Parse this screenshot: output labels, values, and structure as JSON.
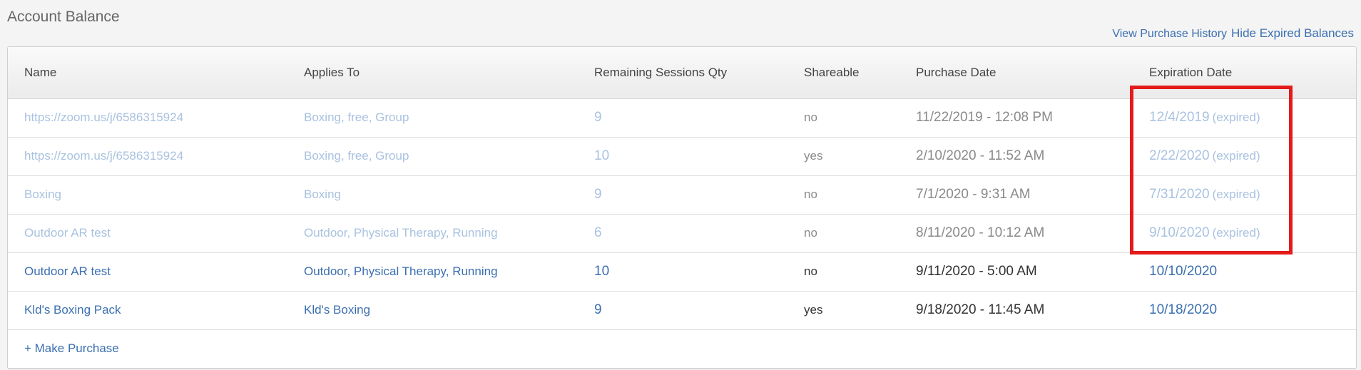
{
  "page": {
    "title": "Account Balance",
    "view_history_label": "View Purchase History",
    "hide_expired_label": "Hide Expired Balances",
    "make_purchase_label": "+ Make Purchase"
  },
  "table": {
    "headers": [
      "Name",
      "Applies To",
      "Remaining Sessions Qty",
      "Shareable",
      "Purchase Date",
      "Expiration Date"
    ],
    "rows": [
      {
        "name": "https://zoom.us/j/6586315924",
        "applies_to": "Boxing, free, Group",
        "remaining": "9",
        "shareable": "no",
        "purchase_date": "11/22/2019 - 12:08 PM",
        "expiration_date": "12/4/2019",
        "expired_label": "(expired)",
        "expired": true
      },
      {
        "name": "https://zoom.us/j/6586315924",
        "applies_to": "Boxing, free, Group",
        "remaining": "10",
        "shareable": "yes",
        "purchase_date": "2/10/2020 - 11:52 AM",
        "expiration_date": "2/22/2020",
        "expired_label": "(expired)",
        "expired": true
      },
      {
        "name": "Boxing",
        "applies_to": "Boxing",
        "remaining": "9",
        "shareable": "no",
        "purchase_date": "7/1/2020 - 9:31 AM",
        "expiration_date": "7/31/2020",
        "expired_label": "(expired)",
        "expired": true
      },
      {
        "name": "Outdoor AR test",
        "applies_to": "Outdoor, Physical Therapy, Running",
        "remaining": "6",
        "shareable": "no",
        "purchase_date": "8/11/2020 - 10:12 AM",
        "expiration_date": "9/10/2020",
        "expired_label": "(expired)",
        "expired": true
      },
      {
        "name": "Outdoor AR test",
        "applies_to": "Outdoor, Physical Therapy, Running",
        "remaining": "10",
        "shareable": "no",
        "purchase_date": "9/11/2020 - 5:00 AM",
        "expiration_date": "10/10/2020",
        "expired_label": "",
        "expired": false
      },
      {
        "name": "Kld's Boxing Pack",
        "applies_to": "Kld's Boxing",
        "remaining": "9",
        "shareable": "yes",
        "purchase_date": "9/18/2020 - 11:45 AM",
        "expiration_date": "10/18/2020",
        "expired_label": "",
        "expired": false
      }
    ]
  },
  "colors": {
    "link": "#3b6fb0",
    "expired_link": "#a9c2e0",
    "highlight": "#e31b1b"
  }
}
